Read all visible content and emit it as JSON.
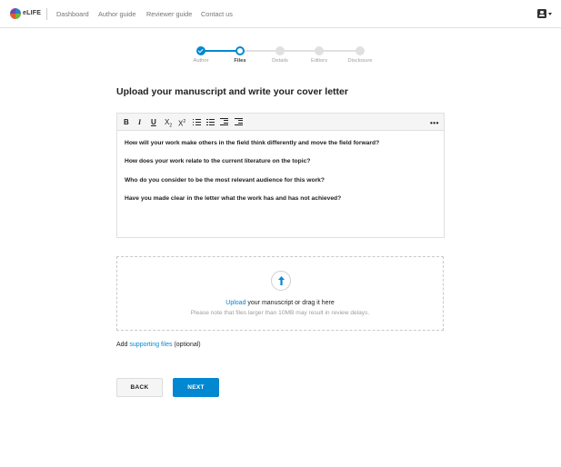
{
  "header": {
    "logo_text": "eLIFE",
    "nav": [
      {
        "label": "Dashboard"
      },
      {
        "label": "Author guide"
      },
      {
        "label": "Reviewer guide"
      },
      {
        "label": "Contact us"
      }
    ]
  },
  "stepper": {
    "steps": [
      {
        "label": "Author",
        "state": "done"
      },
      {
        "label": "Files",
        "state": "current"
      },
      {
        "label": "Details",
        "state": "todo"
      },
      {
        "label": "Editors",
        "state": "todo"
      },
      {
        "label": "Disclosure",
        "state": "todo"
      }
    ]
  },
  "page": {
    "title": "Upload your manuscript and write your cover letter"
  },
  "editor": {
    "toolbar": {
      "bold": "B",
      "italic": "I",
      "underline": "U",
      "subscript": "X",
      "superscript": "X",
      "more": "•••"
    },
    "prompts": [
      "How will your work make others in the field think differently and move the field forward?",
      "How does your work relate to the current literature on the topic?",
      "Who do you consider to be the most relevant audience for this work?",
      "Have you made clear in the letter what the work has and has not achieved?"
    ]
  },
  "upload": {
    "link_text": "Upload",
    "text_rest": " your manuscript or drag it here",
    "note": "Please note that files larger than 10MB may result in review delays."
  },
  "supporting": {
    "prefix": "Add ",
    "link": "supporting files",
    "suffix": " (optional)"
  },
  "buttons": {
    "back": "BACK",
    "next": "NEXT"
  },
  "colors": {
    "accent": "#0288d1",
    "step_inactive": "#e0e0e0"
  }
}
